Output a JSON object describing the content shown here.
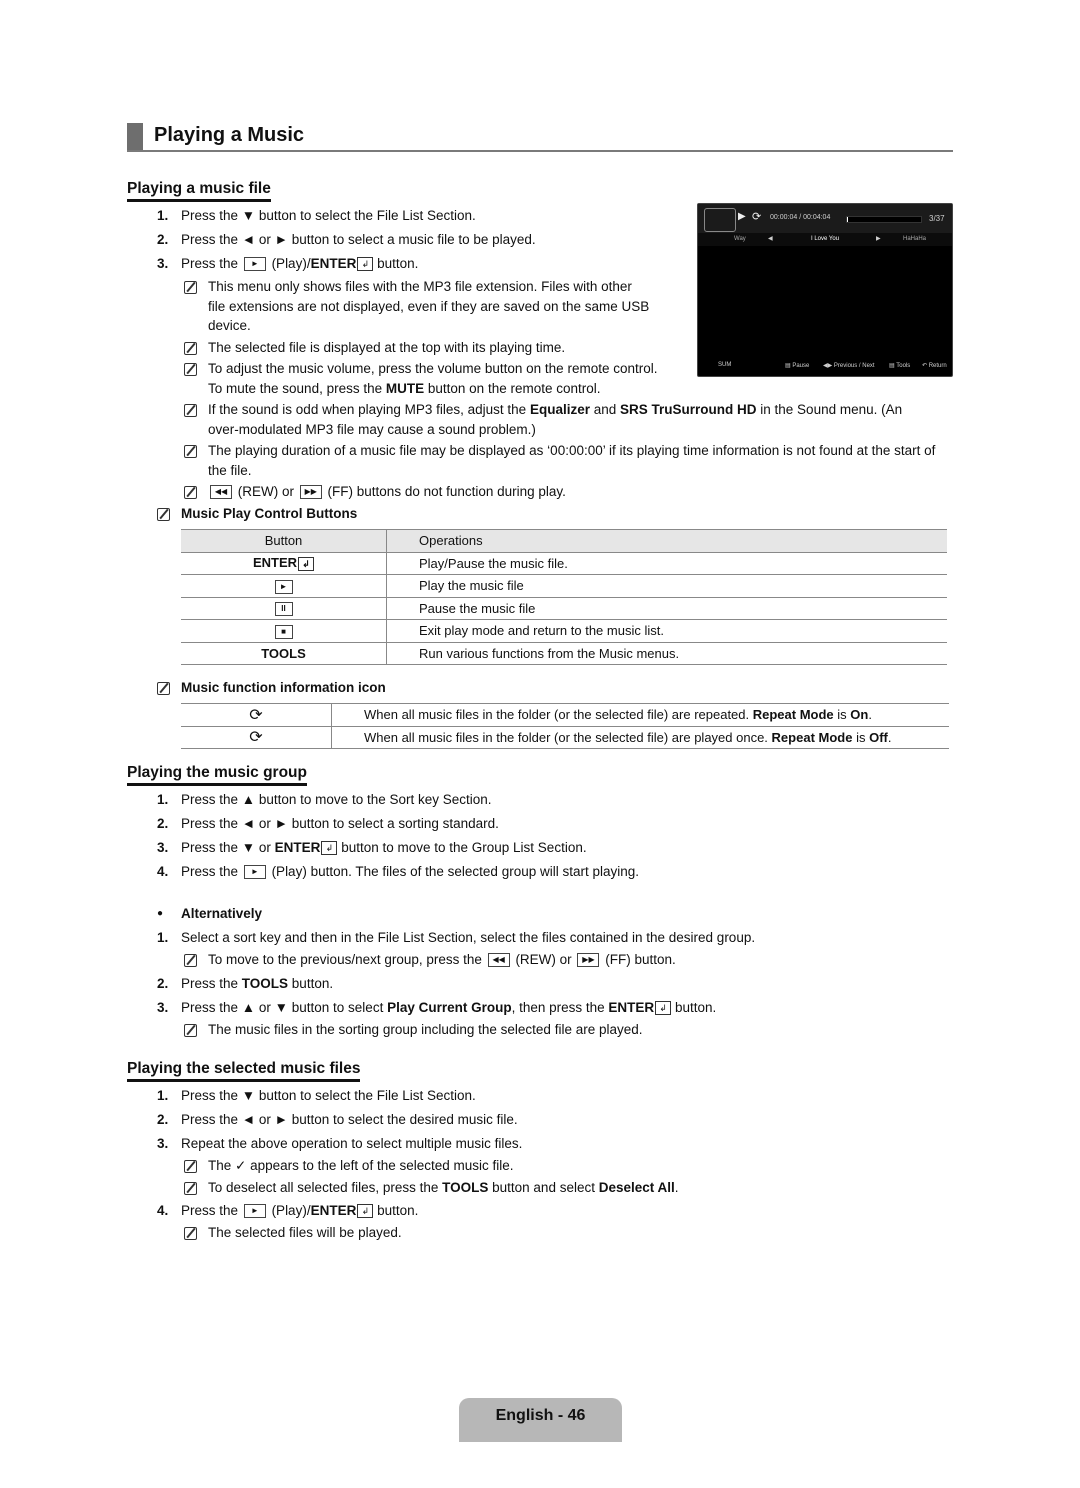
{
  "page_title": "Playing a Music",
  "sections": {
    "file": {
      "title": "Playing a music file",
      "steps": [
        {
          "n": "1.",
          "text": "Press the ▼ button to select the File List Section."
        },
        {
          "n": "2.",
          "text": "Press the ◄ or ► button to select a music file to be played."
        },
        {
          "n": "3.",
          "pre": "Press the",
          "mid": "(Play)/",
          "bold": "ENTER",
          "post": "button."
        }
      ],
      "notes": [
        "This menu only shows files with the MP3 file extension. Files with other",
        "file extensions are not displayed, even if they are saved on the same USB",
        "device.",
        "The selected file is displayed at the top with its playing time.",
        "To adjust the music volume, press the volume button on the remote control.",
        "To mute the sound, press the",
        "MUTE",
        "button on the remote control."
      ],
      "note_sound": {
        "a": "If the sound is odd when playing MP3 files, adjust the ",
        "b1": "Equalizer",
        "c": " and ",
        "b2": "SRS TruSurround HD",
        "d": " in the Sound menu. (An",
        "e": "over-modulated MP3 file may cause a sound problem.)"
      },
      "note_duration": {
        "a": "The playing duration of a music file may be displayed as ‘00:00:00’ if its playing time information is not found at the start of",
        "b": "the file."
      },
      "note_rew": {
        "rew": "(REW) or",
        "ff": "(FF) buttons do not function during play."
      }
    },
    "controls": {
      "title": "Music Play Control Buttons",
      "headers": [
        "Button",
        "Operations"
      ],
      "rows": [
        {
          "button": "ENTER",
          "op": "Play/Pause the music file."
        },
        {
          "button": "play-icon",
          "op": "Play the music file"
        },
        {
          "button": "pause-icon",
          "op": "Pause the music file"
        },
        {
          "button": "stop-icon",
          "op": "Exit play mode and return to the music list."
        },
        {
          "button": "TOOLS",
          "op": "Run various functions from the Music menus."
        }
      ]
    },
    "info_icons": {
      "title": "Music function information icon",
      "rows": [
        {
          "icon": "repeat-on-icon",
          "a": "When all music files in the folder (or the selected file) are repeated. ",
          "b1": "Repeat Mode",
          "c": " is ",
          "b2": "On",
          "d": "."
        },
        {
          "icon": "repeat-off-icon",
          "a": "When all music files in the folder (or the selected file) are played once. ",
          "b1": "Repeat Mode",
          "c": " is ",
          "b2": "Off",
          "d": "."
        }
      ]
    },
    "group": {
      "title": "Playing the music group",
      "steps": [
        {
          "n": "1.",
          "text": "Press the ▲ button to move to the Sort key Section."
        },
        {
          "n": "2.",
          "text": "Press the ◄ or ► button to select a sorting standard."
        },
        {
          "n": "3.",
          "pre": "Press the ▼ or ",
          "bold": "ENTER",
          "post": "button to move to the Group List Section."
        },
        {
          "n": "4.",
          "pre": "Press the",
          "post": "(Play) button. The files of the selected group will start playing."
        }
      ],
      "alt_title": "Alternatively",
      "alt_steps": [
        {
          "n": "1.",
          "text": "Select a sort key and then in the File List Section, select the files contained in the desired group."
        },
        {
          "note_pre": "To move to the previous/next group, press the",
          "note_mid": "(REW) or",
          "note_post": "(FF) button."
        },
        {
          "n": "2.",
          "pre": "Press the ",
          "bold": "TOOLS",
          "post": " button."
        },
        {
          "n": "3.",
          "pre": "Press the ▲ or ▼ button to select ",
          "bold": "Play Current Group",
          "mid": ", then press the ",
          "bold2": "ENTER",
          "post": "button."
        },
        {
          "note": "The music files in the sorting group including the selected file are played."
        }
      ]
    },
    "selected": {
      "title": "Playing the selected music files",
      "steps": [
        {
          "n": "1.",
          "text": "Press the ▼ button to select the File List Section."
        },
        {
          "n": "2.",
          "text": "Press the ◄ or ► button to select the desired music file."
        },
        {
          "n": "3.",
          "text": "Repeat the above operation to select multiple music files."
        },
        {
          "note_pre": "The",
          "note_post": "appears to the left of the selected music file."
        },
        {
          "note_pre": "To deselect all selected files, press the ",
          "b1": "TOOLS",
          "mid": " button and select ",
          "b2": "Deselect All",
          "end": "."
        },
        {
          "n": "4.",
          "pre": "Press the",
          "mid": "(Play)/",
          "bold": "ENTER",
          "post": "button."
        },
        {
          "note": "The selected files will be played."
        }
      ]
    }
  },
  "tv_screen": {
    "time": "00:00:04 / 00:04:04",
    "count": "3/37",
    "progress_fraction": 0.016,
    "tracks": [
      "Way",
      "I Love You",
      "HaHaHa"
    ],
    "device": "SUM",
    "hints": {
      "pause": "Pause",
      "prevnext": "Previous / Next",
      "tools": "Tools",
      "return": "Return"
    }
  },
  "footer": "English - 46"
}
